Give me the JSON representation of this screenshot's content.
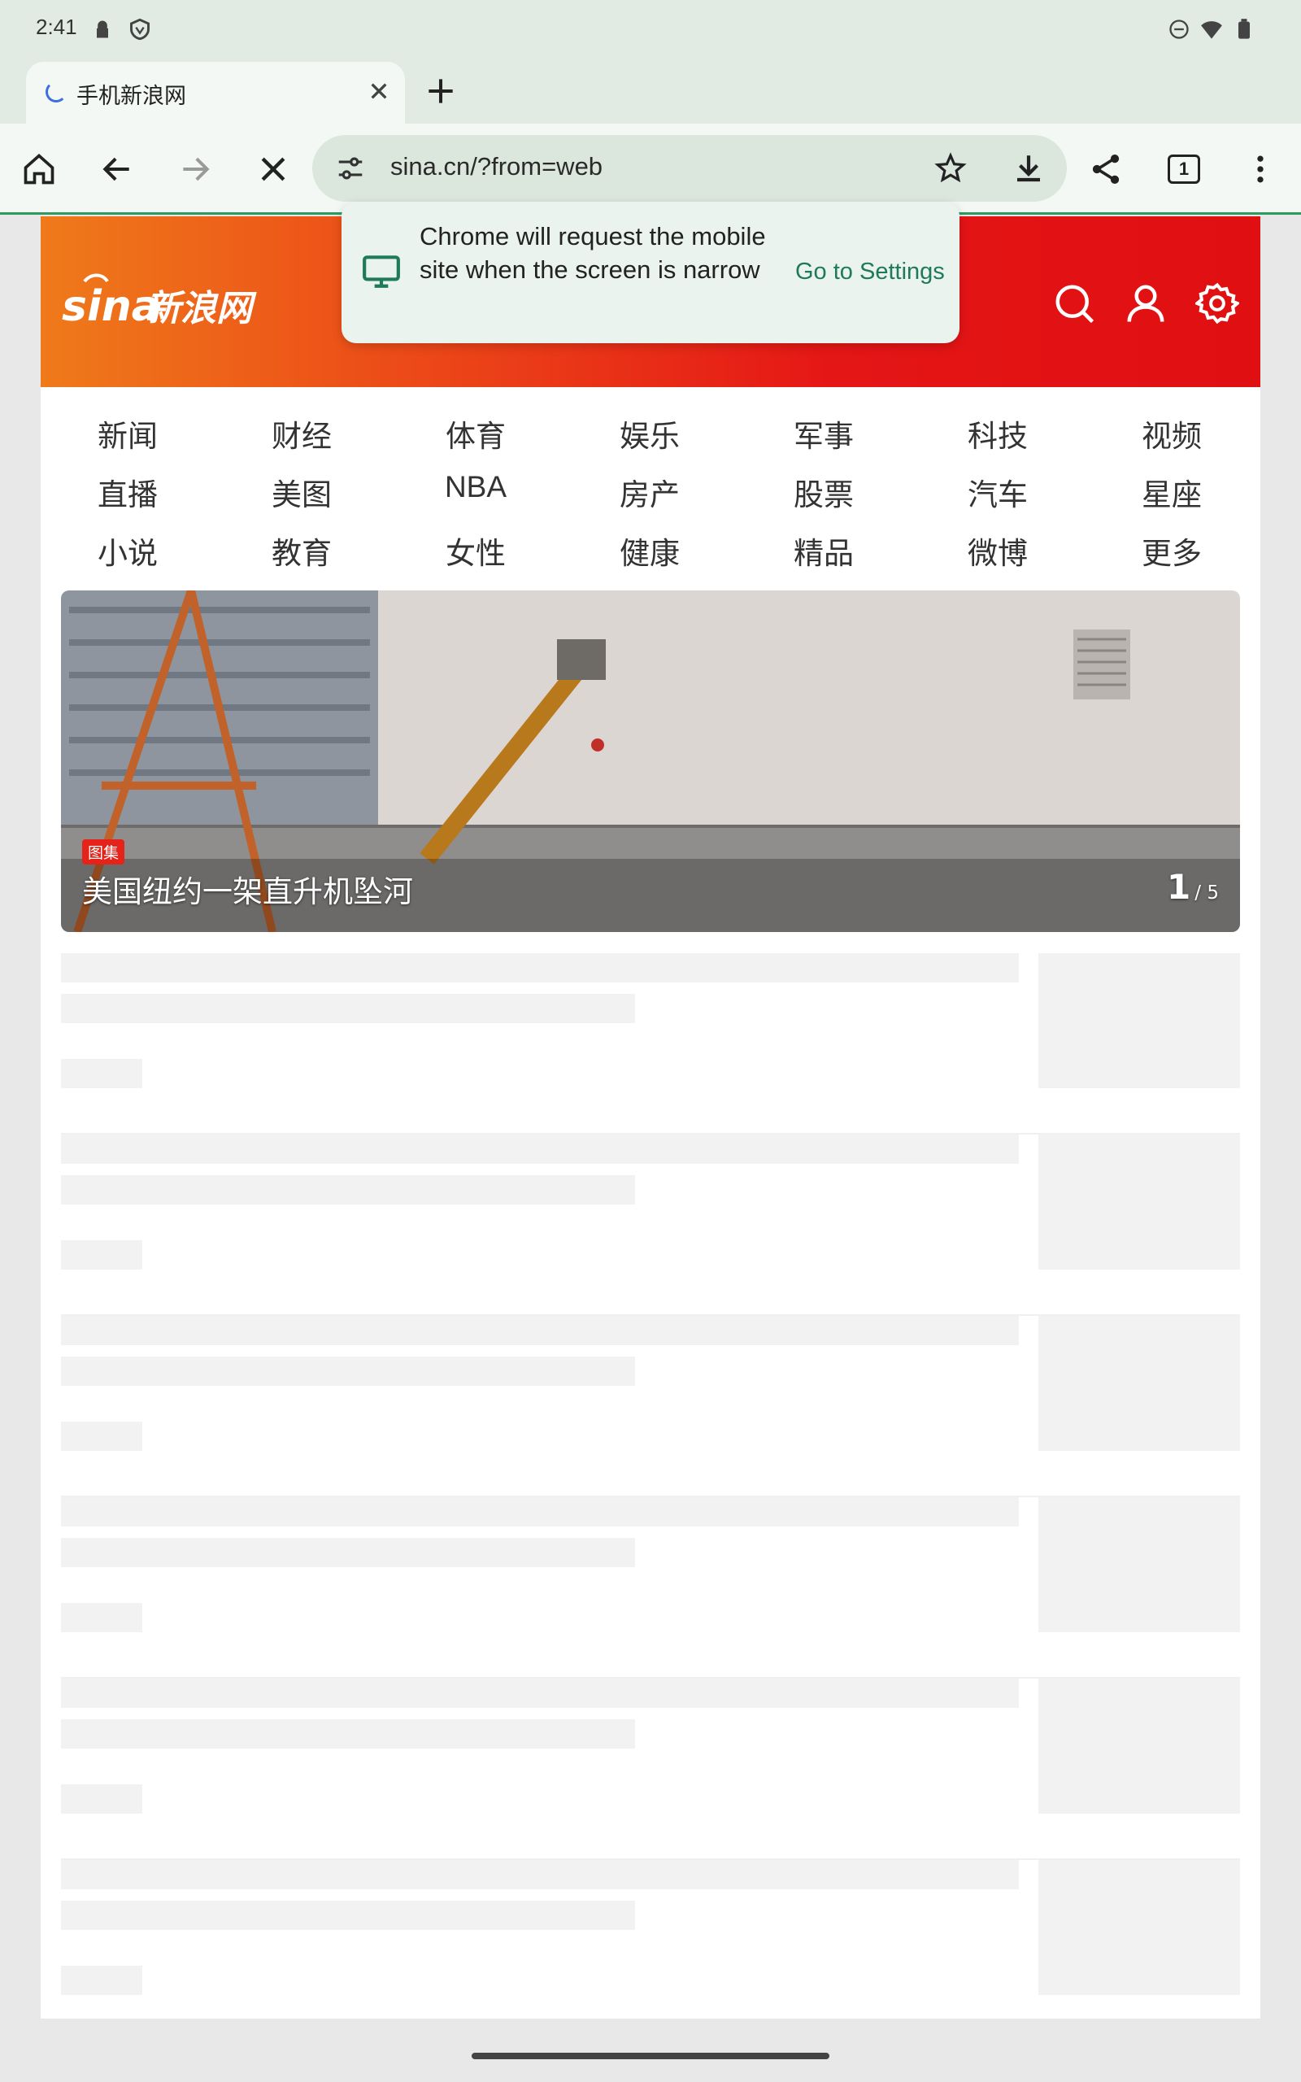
{
  "status_bar": {
    "time": "2:41",
    "icons": [
      "lock-icon",
      "shield-icon",
      "dnd-icon",
      "wifi-icon",
      "battery-icon"
    ]
  },
  "tabs": [
    {
      "title": "手机新浪网",
      "loading": true
    }
  ],
  "toolbar": {
    "url": "sina.cn/?from=web",
    "tab_count": "1"
  },
  "popup": {
    "message": "Chrome will request the mobile site when the screen is narrow",
    "action_label": "Go to Settings"
  },
  "site": {
    "logo_text": "sina新浪网",
    "brand_color": "#e51616",
    "nav_rows": [
      [
        "新闻",
        "财经",
        "体育",
        "娱乐",
        "军事",
        "科技",
        "视频"
      ],
      [
        "直播",
        "美图",
        "NBA",
        "房产",
        "股票",
        "汽车",
        "星座"
      ],
      [
        "小说",
        "教育",
        "女性",
        "健康",
        "精品",
        "微博",
        "更多"
      ]
    ],
    "hero": {
      "badge": "图集",
      "title": "美国纽约一架直升机坠河",
      "current": "1",
      "total": "/ 5"
    }
  }
}
